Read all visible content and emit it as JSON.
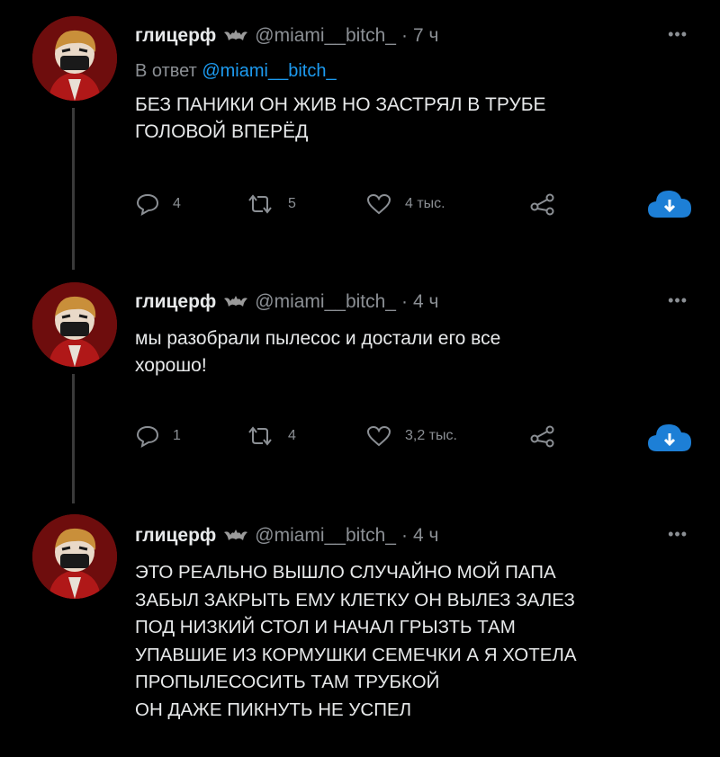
{
  "tweets": [
    {
      "name": "глицерф",
      "handle": "@miami__bitch_",
      "time": "7 ч",
      "reply_prefix": "В ответ ",
      "reply_mention": "@miami__bitch_",
      "text": "БЕЗ ПАНИКИ ОН ЖИВ НО ЗАСТРЯЛ В ТРУБЕ\nГОЛОВОЙ ВПЕРЁД",
      "replies": "4",
      "retweets": "5",
      "likes": "4 тыс."
    },
    {
      "name": "глицерф",
      "handle": "@miami__bitch_",
      "time": "4 ч",
      "text": "мы разобрали пылесос и достали его все\nхорошо!",
      "replies": "1",
      "retweets": "4",
      "likes": "3,2 тыс."
    },
    {
      "name": "глицерф",
      "handle": "@miami__bitch_",
      "time": "4 ч",
      "text": "ЭТО РЕАЛЬНО ВЫШЛО СЛУЧАЙНО МОЙ ПАПА\nЗАБЫЛ ЗАКРЫТЬ ЕМУ КЛЕТКУ ОН ВЫЛЕЗ ЗАЛЕЗ\nПОД НИЗКИЙ СТОЛ И НАЧАЛ ГРЫЗТЬ ТАМ\nУПАВШИЕ ИЗ КОРМУШКИ СЕМЕЧКИ А Я ХОТЕЛА\nПРОПЫЛЕСОСИТЬ ТАМ ТРУБКОЙ\nОН ДАЖЕ ПИКНУТЬ НЕ УСПЕЛ"
    }
  ],
  "more_label": "•••",
  "dot": "·",
  "colors": {
    "background": "#000000",
    "text": "#e7e9ea",
    "muted": "#8b8f94",
    "link": "#1d9bf0",
    "download": "#1d7fd6"
  },
  "icons": [
    "reply-icon",
    "retweet-icon",
    "like-icon",
    "share-icon",
    "download-icon",
    "bat-icon",
    "more-icon"
  ]
}
